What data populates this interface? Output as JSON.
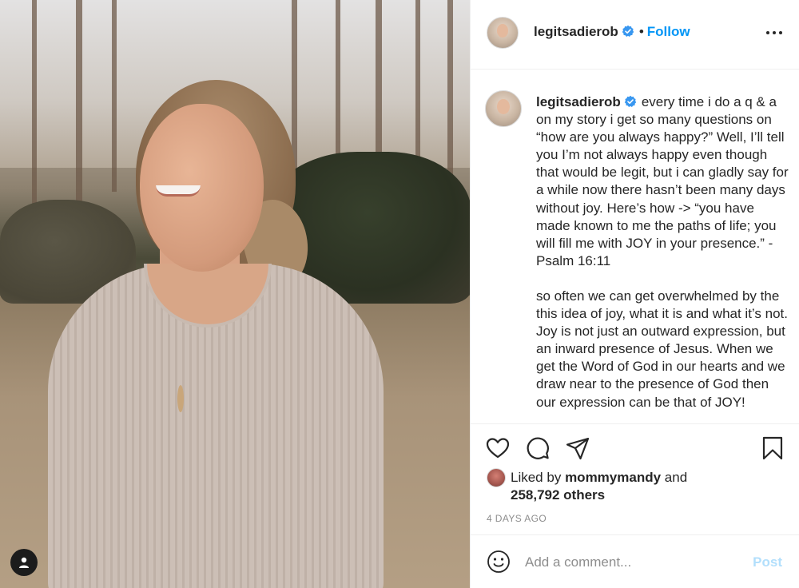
{
  "post": {
    "author": "legitsadierob",
    "verified": true,
    "follow_label": "Follow",
    "separator": "•",
    "caption_paragraph_1": "every time i do a q & a on my story i get so many questions on “how are you always happy?” Well, I’ll tell you I’m not always happy even though that would be legit, but i can gladly say for a while now there hasn’t been many days without joy. Here’s how -> “you have made known to me the paths of life; you will fill me with JOY in your presence.” -Psalm 16:11",
    "caption_paragraph_2": "so often we can get overwhelmed by the this idea of joy, what it is and what it’s not. Joy is not just an outward expression, but an inward presence of Jesus. When we get the Word of God in our hearts and we draw near to the presence of God then our expression can be that of JOY!"
  },
  "likes": {
    "prefix": "Liked by",
    "liked_by_user": "mommymandy",
    "conjunction": "and",
    "others_count": "258,792 others"
  },
  "timestamp": "4 DAYS AGO",
  "comment": {
    "placeholder": "Add a comment...",
    "post_label": "Post"
  },
  "icons": {
    "verified": "verified-badge-icon",
    "more": "more-options-icon",
    "like": "heart-icon",
    "comment": "comment-icon",
    "share": "send-icon",
    "save": "bookmark-icon",
    "emoji": "emoji-icon",
    "user_tag": "user-tag-icon"
  },
  "colors": {
    "link_blue": "#0095f6",
    "post_disabled": "#b2dffc",
    "muted_text": "#8e8e8e",
    "text": "#262626"
  }
}
